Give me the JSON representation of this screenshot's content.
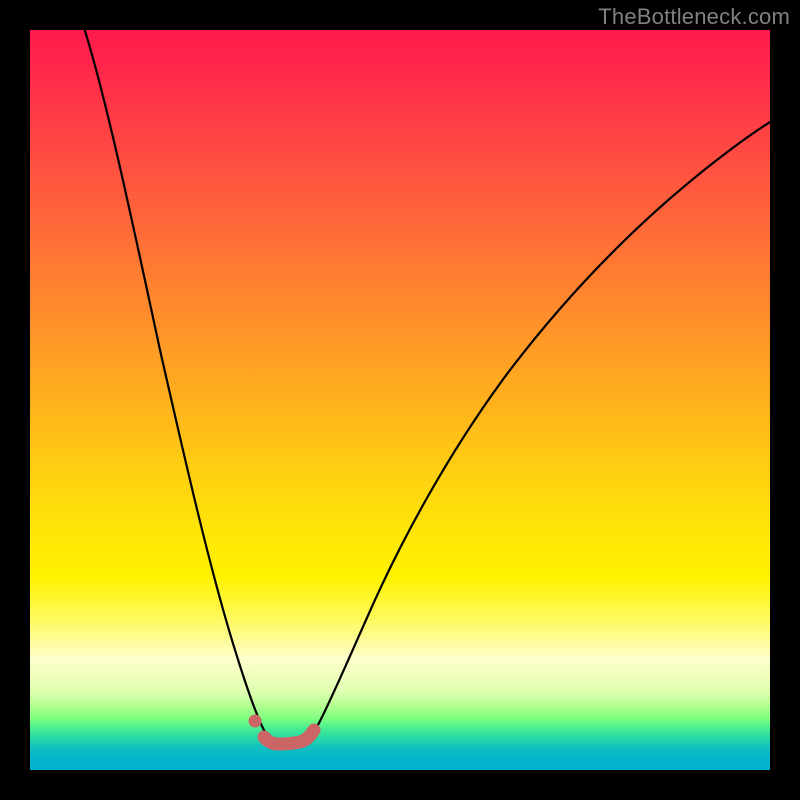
{
  "watermark": {
    "text": "TheBottleneck.com"
  },
  "colors": {
    "frame_background": "#000000",
    "curve_stroke": "#000000",
    "marker_fill": "#cc6666",
    "marker_stroke": "#cc6666",
    "watermark_text": "#808080"
  },
  "chart_data": {
    "type": "line",
    "title": "",
    "xlabel": "",
    "ylabel": "",
    "xlim": [
      0,
      100
    ],
    "ylim": [
      0,
      100
    ],
    "grid": false,
    "legend": false,
    "series": [
      {
        "name": "bottleneck-curve",
        "x": [
          0,
          2,
          5,
          8,
          11,
          14,
          17,
          20,
          23,
          26,
          28,
          30,
          32,
          33,
          34,
          35,
          36,
          37,
          38,
          40,
          43,
          47,
          52,
          58,
          65,
          73,
          82,
          92,
          100
        ],
        "y": [
          100,
          90,
          78,
          66,
          55,
          45,
          36,
          28,
          21,
          14,
          10,
          7,
          4.5,
          3.8,
          3.5,
          3.5,
          3.6,
          4.0,
          5.0,
          7.5,
          12,
          18,
          26,
          35,
          44,
          53,
          62,
          71,
          78
        ]
      }
    ],
    "markers": [
      {
        "name": "marker-point",
        "x": 30.5,
        "y": 6.8,
        "r": 0.9
      },
      {
        "name": "trough-segment",
        "x_start": 31.5,
        "y_start": 4.5,
        "x_end": 37.5,
        "y_end": 5.0,
        "thickness": 1.6
      }
    ],
    "background_gradient_note": "vertical red-to-green heat gradient; plot minimum sits in green band"
  }
}
